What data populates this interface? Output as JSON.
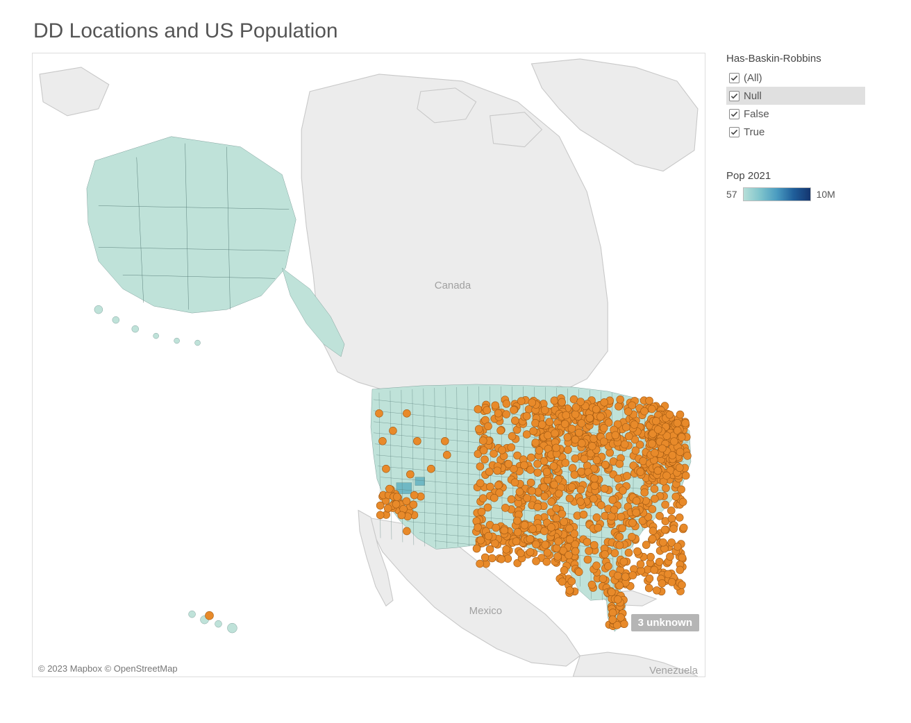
{
  "title": "DD Locations and US Population",
  "attribution": "© 2023 Mapbox © OpenStreetMap",
  "unknown_badge": "3 unknown",
  "filter": {
    "title": "Has-Baskin-Robbins",
    "items": [
      {
        "label": "(All)",
        "checked": true,
        "selected": false
      },
      {
        "label": "Null",
        "checked": true,
        "selected": true
      },
      {
        "label": "False",
        "checked": true,
        "selected": false
      },
      {
        "label": "True",
        "checked": true,
        "selected": false
      }
    ]
  },
  "legend": {
    "title": "Pop 2021",
    "min_label": "57",
    "max_label": "10M",
    "gradient_stops": [
      "#b6dfd8",
      "#7fc4cc",
      "#4a9bc0",
      "#1f5e9a",
      "#14356f"
    ]
  },
  "map_labels": {
    "canada": "Canada",
    "mexico": "Mexico",
    "venezuela": "Venezuela"
  },
  "chart_data": {
    "type": "map",
    "title": "DD Locations and US Population",
    "description": "Choropleth of US counties colored by 2021 population, overlaid with orange point markers for Dunkin' Donuts locations, filterable by Has-Baskin-Robbins status.",
    "choropleth": {
      "geography": "US counties",
      "variable": "Pop 2021",
      "scale_min": 57,
      "scale_max": 10000000
    },
    "marker_color": "#e88a2a",
    "point_layer": "DD Locations",
    "filter_field": "Has-Baskin-Robbins",
    "filter_options": [
      "(All)",
      "Null",
      "False",
      "True"
    ],
    "unknown_count": 3
  }
}
